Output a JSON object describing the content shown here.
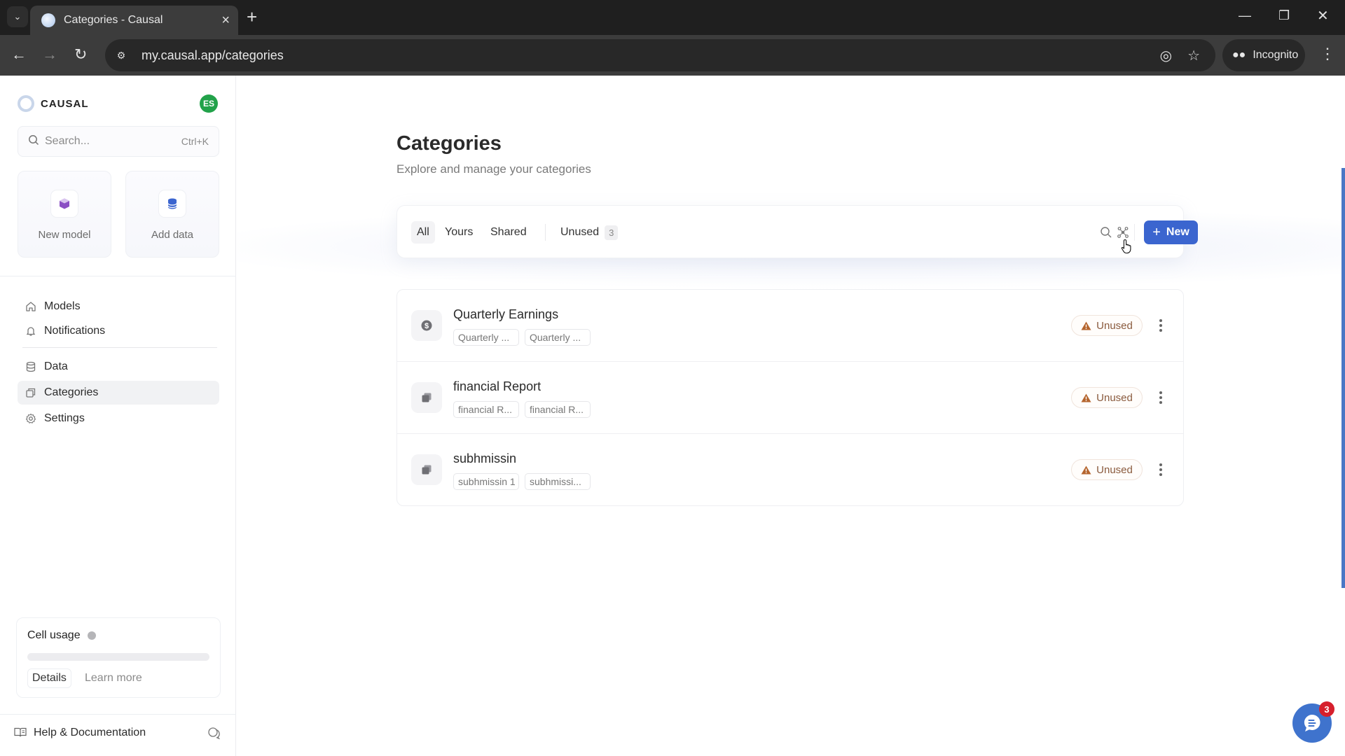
{
  "browser": {
    "tab_title": "Categories - Causal",
    "url": "my.causal.app/categories",
    "incognito_label": "Incognito"
  },
  "sidebar": {
    "brand": "CAUSAL",
    "avatar_initials": "ES",
    "search": {
      "placeholder": "Search...",
      "shortcut": "Ctrl+K"
    },
    "quick_actions": [
      {
        "label": "New model",
        "icon": "cube-icon",
        "color": "#8b4fc4"
      },
      {
        "label": "Add data",
        "icon": "database-icon",
        "color": "#3b65cf"
      }
    ],
    "nav": [
      {
        "label": "Models",
        "icon": "home-icon"
      },
      {
        "label": "Notifications",
        "icon": "bell-icon"
      },
      {
        "label": "Data",
        "icon": "database-icon"
      },
      {
        "label": "Categories",
        "icon": "copy-icon",
        "active": true
      },
      {
        "label": "Settings",
        "icon": "gear-icon"
      }
    ],
    "cell_usage": {
      "title": "Cell usage",
      "progress_percent": 0,
      "details_label": "Details",
      "learn_more_label": "Learn more"
    },
    "help_label": "Help & Documentation"
  },
  "main": {
    "title": "Categories",
    "subtitle": "Explore and manage your categories",
    "filters": [
      {
        "label": "All",
        "active": true
      },
      {
        "label": "Yours"
      },
      {
        "label": "Shared"
      },
      {
        "label": "Unused",
        "count": "3"
      }
    ],
    "new_button_label": "New",
    "categories": [
      {
        "name": "Quarterly Earnings",
        "icon": "dollar-icon",
        "chips": [
          "Quarterly ...",
          "Quarterly ..."
        ],
        "status": "Unused"
      },
      {
        "name": "financial Report",
        "icon": "copy-icon",
        "chips": [
          "financial R...",
          "financial R..."
        ],
        "status": "Unused"
      },
      {
        "name": "subhmissin",
        "icon": "copy-icon",
        "chips": [
          "subhmissin 1",
          "subhmissi..."
        ],
        "status": "Unused"
      }
    ]
  },
  "chat_widget": {
    "unread_count": "3"
  },
  "colors": {
    "accent": "#3b65cf",
    "warning": "#b5652e",
    "avatar": "#22a24a",
    "badge_red": "#d61f2c"
  }
}
